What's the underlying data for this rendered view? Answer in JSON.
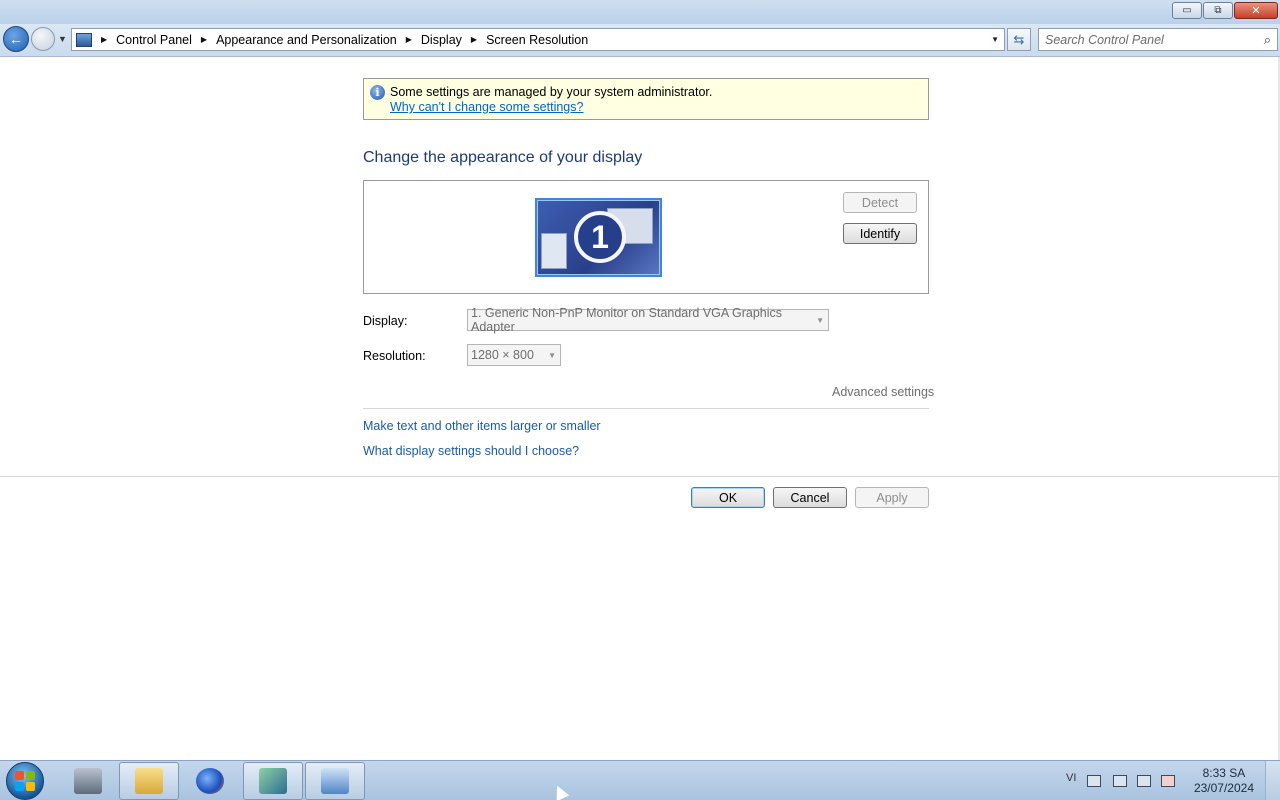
{
  "window": {
    "controls": {
      "minimize": "▭",
      "restore": "⧉",
      "close": "✕"
    }
  },
  "nav": {
    "breadcrumb": [
      "Control Panel",
      "Appearance and Personalization",
      "Display",
      "Screen Resolution"
    ],
    "search_placeholder": "Search Control Panel"
  },
  "info": {
    "message": "Some settings are managed by your system administrator.",
    "link": "Why can't I change some settings?"
  },
  "main": {
    "heading": "Change the appearance of your display",
    "monitor_number": "1",
    "detect_label": "Detect",
    "identify_label": "Identify",
    "display_label": "Display:",
    "display_value": "1. Generic Non-PnP Monitor on Standard VGA Graphics Adapter",
    "resolution_label": "Resolution:",
    "resolution_value": "1280 × 800",
    "advanced_label": "Advanced settings",
    "link_text_size": "Make text and other items larger or smaller",
    "link_which_settings": "What display settings should I choose?"
  },
  "buttons": {
    "ok": "OK",
    "cancel": "Cancel",
    "apply": "Apply"
  },
  "taskbar": {
    "items": [
      "server-manager-icon",
      "windows-explorer-icon",
      "firefox-icon",
      "tools-icon",
      "control-panel-icon"
    ],
    "language": "VI",
    "time": "8:33 SA",
    "date": "23/07/2024"
  },
  "colors": {
    "link": "#1e5aa8",
    "heading": "#1e3a7b",
    "infobar_bg": "#ffffe1",
    "titlebar": "#b9d1ea"
  }
}
